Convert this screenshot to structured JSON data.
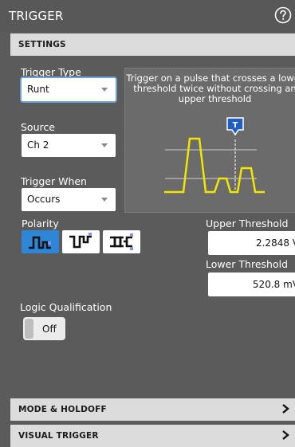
{
  "panel": {
    "title": "TRIGGER",
    "help_icon": "help-circle-icon"
  },
  "settings": {
    "header": "SETTINGS",
    "trigger_type": {
      "label": "Trigger Type",
      "value": "Runt"
    },
    "source": {
      "label": "Source",
      "value": "Ch 2"
    },
    "trigger_when": {
      "label": "Trigger When",
      "value": "Occurs"
    },
    "description": "Trigger on a pulse that crosses a lower threshold twice without crossing an upper threshold",
    "diagram_marker": "T",
    "polarity": {
      "label": "Polarity",
      "options": [
        "positive-runt-icon",
        "negative-runt-icon",
        "either-runt-icon"
      ],
      "selected": 0
    },
    "upper_threshold": {
      "label": "Upper Threshold",
      "value": "2.2848 V"
    },
    "lower_threshold": {
      "label": "Lower Threshold",
      "value": "520.8 mV"
    },
    "logic_qualification": {
      "label": "Logic Qualification",
      "toggle": "Off"
    }
  },
  "sections": {
    "mode_holdoff": "MODE & HOLDOFF",
    "visual_trigger": "VISUAL TRIGGER"
  },
  "colors": {
    "accent": "#2e86d6",
    "waveform": "#f2e600",
    "marker": "#1f5fbf"
  }
}
